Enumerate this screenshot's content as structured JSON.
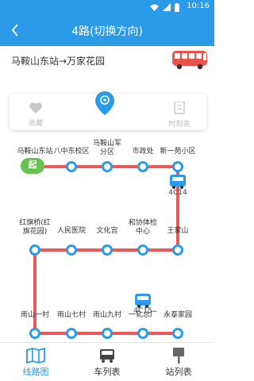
{
  "status": {
    "time": "10:16"
  },
  "header": {
    "title": "4路(切换方向)"
  },
  "route": {
    "direction": "马鞍山东站→万家花园"
  },
  "info_card": {
    "left_label": "收藏",
    "right_label": "时刻表"
  },
  "line": {
    "start_badge": "起",
    "stops_row1": [
      "马鞍山东站",
      "八中东校区",
      "马鞍山军分区",
      "市政处",
      "新一苑小区"
    ],
    "stops_row2": [
      "红旗桥(红旗花园)",
      "人民医院",
      "文化宫",
      "和协体检中心",
      "王家山"
    ],
    "stops_row3": [
      "雨山一村",
      "雨山七村",
      "雨山九村",
      "一轧总厂",
      "永泰家园"
    ],
    "bus_labels": [
      "4C14",
      "4C15"
    ]
  },
  "colors": {
    "primary": "#2b9ae8",
    "route_line": "#e85a5a",
    "start": "#69c250",
    "stop_fill": "#2b9ae8"
  },
  "tabs": [
    {
      "label": "线路图",
      "icon": "map-icon",
      "active": true
    },
    {
      "label": "车列表",
      "icon": "bus-icon",
      "active": false
    },
    {
      "label": "站列表",
      "icon": "station-sign-icon",
      "active": false
    }
  ]
}
